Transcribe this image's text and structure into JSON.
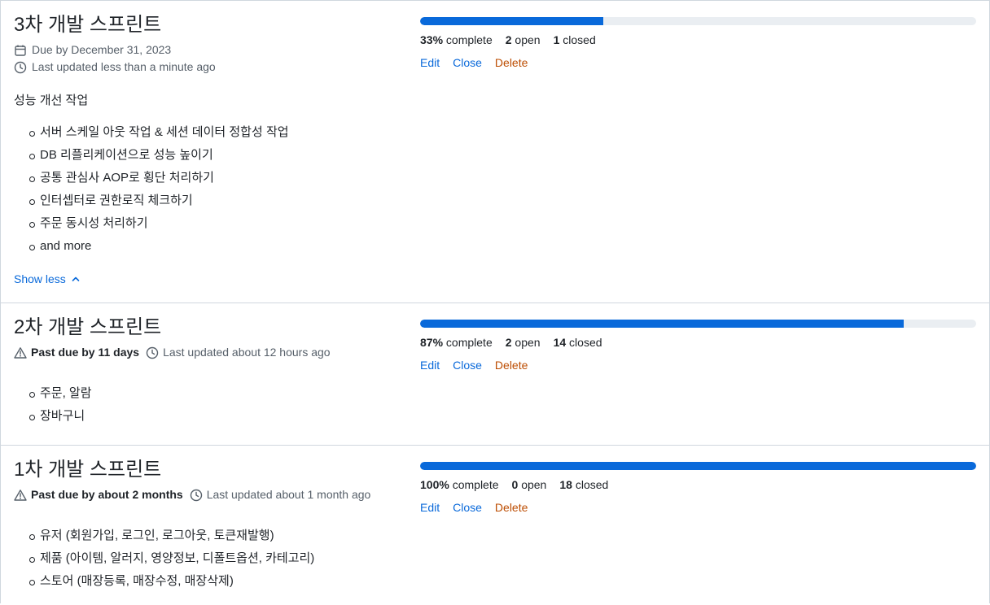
{
  "milestones": [
    {
      "title": "3차 개발 스프린트",
      "due": "Due by December 31, 2023",
      "updated": "Last updated less than a minute ago",
      "progress": 0.33,
      "percent": "33%",
      "complete_label": "complete",
      "open_count": "2",
      "open_label": "open",
      "closed_count": "1",
      "closed_label": "closed",
      "description_heading": "성능 개선 작업",
      "items": [
        "서버 스케일 아웃 작업 & 세션 데이터 정합성 작업",
        "DB 리플리케이션으로 성능 높이기",
        "공통 관심사 AOP로 횡단 처리하기",
        "인터셉터로 권한로직 체크하기",
        "주문 동시성 처리하기",
        "and more"
      ],
      "toggle_label": "Show less"
    },
    {
      "title": "2차 개발 스프린트",
      "past_due": "Past due by 11 days",
      "updated": "Last updated about 12 hours ago",
      "progress": 0.87,
      "percent": "87%",
      "complete_label": "complete",
      "open_count": "2",
      "open_label": "open",
      "closed_count": "14",
      "closed_label": "closed",
      "items": [
        "주문, 알람",
        "장바구니"
      ]
    },
    {
      "title": "1차 개발 스프린트",
      "past_due": "Past due by about 2 months",
      "updated": "Last updated about 1 month ago",
      "progress": 1.0,
      "percent": "100%",
      "complete_label": "complete",
      "open_count": "0",
      "open_label": "open",
      "closed_count": "18",
      "closed_label": "closed",
      "items": [
        "유저 (회원가입, 로그인, 로그아웃, 토큰재발행)",
        "제품 (아이템, 알러지, 영양정보, 디폴트옵션, 카테고리)",
        "스토어 (매장등록, 매장수정, 매장삭제)"
      ]
    }
  ],
  "actions": {
    "edit": "Edit",
    "close": "Close",
    "delete": "Delete"
  },
  "colors": {
    "accent": "#0969da",
    "danger": "#bc4c00",
    "track": "#eaeef2",
    "border": "#d0d7de"
  },
  "icons": {
    "calendar": "calendar-icon",
    "clock": "clock-icon",
    "alert": "alert-icon",
    "chevron": "chevron-up-icon"
  }
}
